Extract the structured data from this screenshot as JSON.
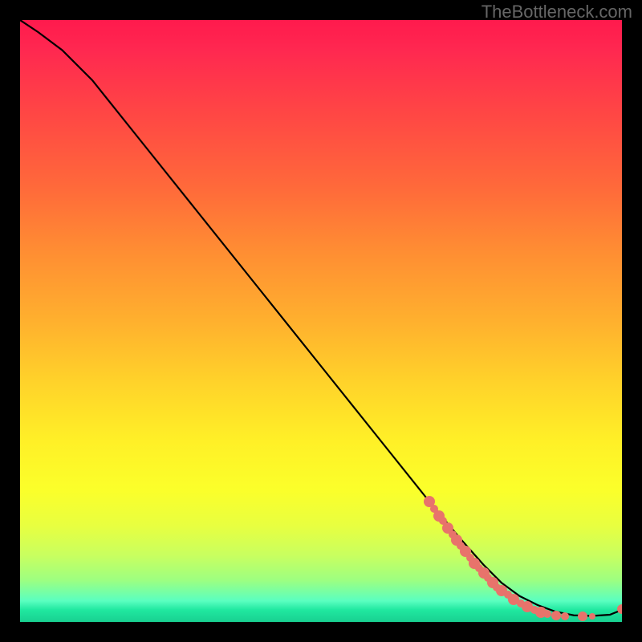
{
  "watermark": "TheBottleneck.com",
  "chart_data": {
    "type": "line",
    "title": "",
    "xlabel": "",
    "ylabel": "",
    "xlim": [
      0,
      100
    ],
    "ylim": [
      0,
      100
    ],
    "curve": {
      "name": "bottleneck-curve",
      "x": [
        0,
        3,
        7,
        12,
        20,
        30,
        40,
        50,
        60,
        68,
        73,
        77,
        80,
        83,
        86,
        89,
        92,
        95,
        98,
        100
      ],
      "y": [
        100,
        98,
        95,
        90,
        80,
        67.5,
        55,
        42.5,
        30,
        20,
        14,
        9.5,
        6.5,
        4.3,
        2.8,
        1.7,
        1.1,
        1.0,
        1.2,
        2.0
      ]
    },
    "scatter_cluster": {
      "name": "data-markers",
      "points": [
        {
          "x": 68.0,
          "y": 20.0,
          "r": 7
        },
        {
          "x": 68.8,
          "y": 18.8,
          "r": 5
        },
        {
          "x": 69.6,
          "y": 17.6,
          "r": 7
        },
        {
          "x": 70.2,
          "y": 16.8,
          "r": 5
        },
        {
          "x": 71.0,
          "y": 15.6,
          "r": 7
        },
        {
          "x": 71.8,
          "y": 14.6,
          "r": 5
        },
        {
          "x": 72.5,
          "y": 13.6,
          "r": 7
        },
        {
          "x": 73.2,
          "y": 12.7,
          "r": 5
        },
        {
          "x": 74.0,
          "y": 11.7,
          "r": 7
        },
        {
          "x": 74.8,
          "y": 10.7,
          "r": 5
        },
        {
          "x": 75.5,
          "y": 9.8,
          "r": 7
        },
        {
          "x": 76.2,
          "y": 8.9,
          "r": 5
        },
        {
          "x": 77.0,
          "y": 8.1,
          "r": 7
        },
        {
          "x": 77.7,
          "y": 7.3,
          "r": 5
        },
        {
          "x": 78.5,
          "y": 6.5,
          "r": 7
        },
        {
          "x": 79.2,
          "y": 5.8,
          "r": 5
        },
        {
          "x": 80.0,
          "y": 5.2,
          "r": 7
        },
        {
          "x": 81.0,
          "y": 4.5,
          "r": 5
        },
        {
          "x": 82.0,
          "y": 3.8,
          "r": 7
        },
        {
          "x": 83.2,
          "y": 3.1,
          "r": 5
        },
        {
          "x": 84.3,
          "y": 2.5,
          "r": 7
        },
        {
          "x": 85.5,
          "y": 2.0,
          "r": 5
        },
        {
          "x": 86.5,
          "y": 1.6,
          "r": 7
        },
        {
          "x": 87.6,
          "y": 1.3,
          "r": 5
        },
        {
          "x": 89.0,
          "y": 1.1,
          "r": 6
        },
        {
          "x": 90.5,
          "y": 1.0,
          "r": 5
        },
        {
          "x": 93.5,
          "y": 1.0,
          "r": 6
        },
        {
          "x": 95.0,
          "y": 1.0,
          "r": 4
        },
        {
          "x": 100.0,
          "y": 2.1,
          "r": 6
        }
      ]
    }
  }
}
